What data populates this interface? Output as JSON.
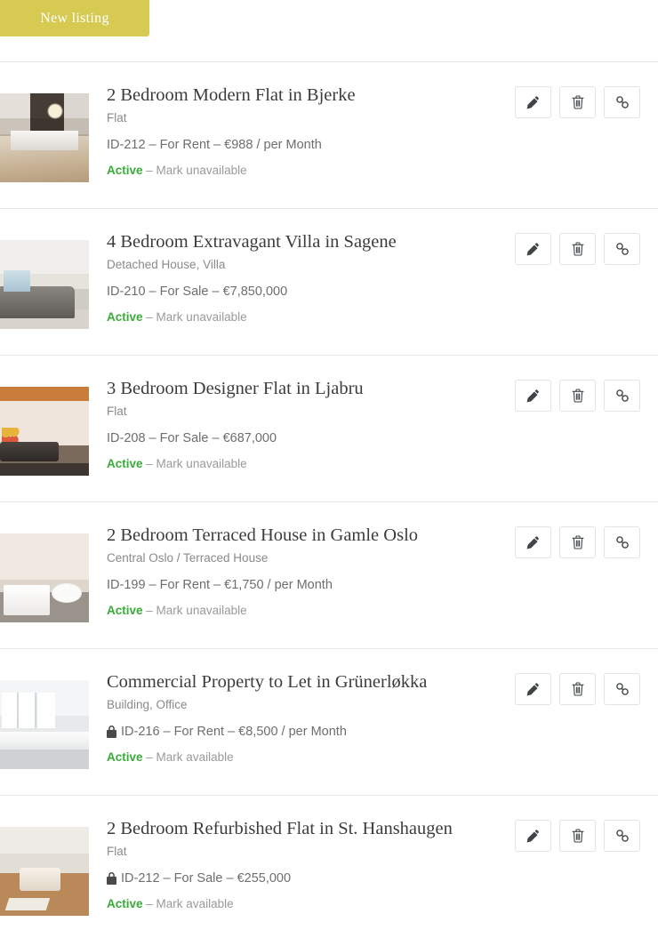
{
  "toolbar": {
    "new_listing_label": "New listing",
    "button_color": "#d6ca53"
  },
  "colors": {
    "active": "#3aab3a",
    "title": "#3c3c3c",
    "muted": "#8a8a8a",
    "divider": "#e8e8e8"
  },
  "icons": {
    "edit": "pencil-icon",
    "delete": "trash-icon",
    "link": "chain-link-icon",
    "private": "lock-icon"
  },
  "listings": [
    {
      "title": "2 Bedroom Modern Flat in Bjerke",
      "type": "Flat",
      "meta": "ID-212 – For Rent – €988 / per Month",
      "locked": false,
      "status": "Active",
      "status_action": "– Mark unavailable"
    },
    {
      "title": "4 Bedroom Extravagant Villa in Sagene",
      "type": "Detached House, Villa",
      "meta": "ID-210 – For Sale – €7,850,000",
      "locked": false,
      "status": "Active",
      "status_action": "– Mark unavailable"
    },
    {
      "title": "3 Bedroom Designer Flat in Ljabru",
      "type": "Flat",
      "meta": "ID-208 – For Sale – €687,000",
      "locked": false,
      "status": "Active",
      "status_action": "– Mark unavailable"
    },
    {
      "title": "2 Bedroom Terraced House in Gamle Oslo",
      "type": "Central Oslo / Terraced House",
      "meta": "ID-199 – For Rent – €1,750 / per Month",
      "locked": false,
      "status": "Active",
      "status_action": "– Mark unavailable"
    },
    {
      "title": "Commercial Property to Let in Grünerløkka",
      "type": "Building, Office",
      "meta": "ID-216 – For Rent – €8,500 / per Month",
      "locked": true,
      "status": "Active",
      "status_action": "– Mark available"
    },
    {
      "title": "2 Bedroom Refurbished Flat in St. Hanshaugen",
      "type": "Flat",
      "meta": "ID-212 – For Sale – €255,000",
      "locked": true,
      "status": "Active",
      "status_action": "– Mark available"
    }
  ]
}
